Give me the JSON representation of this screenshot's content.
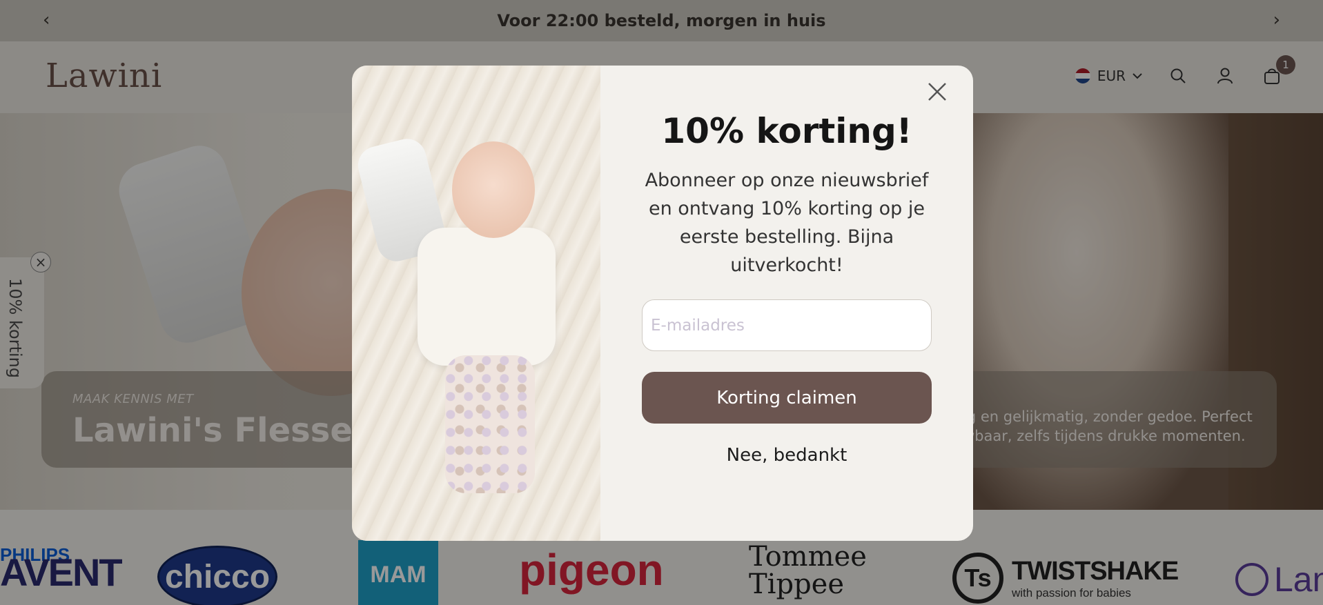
{
  "announcement": {
    "text": "Voor 22:00 besteld, morgen in huis",
    "prev_icon": "chevron-left-icon",
    "next_icon": "chevron-right-icon"
  },
  "header": {
    "logo": "Lawini",
    "currency": "EUR",
    "currency_icon": "netherlands-flag-icon",
    "cart_count": "1",
    "colors": {
      "accent": "#6b5550",
      "logo": "#6a5048"
    }
  },
  "hero": {
    "kicker": "MAAK KENNIS MET",
    "headline": "Lawini's Flessenv",
    "description": "ig en gelijkmatig, zonder gedoe. Perfect wbaar, zelfs tijdens drukke momenten."
  },
  "side_tab": {
    "label": "10% korting",
    "close_icon": "close-icon"
  },
  "brands": [
    {
      "name": "PHILIPS",
      "sub": "AVENT"
    },
    {
      "name": "chicco"
    },
    {
      "name": "MAM"
    },
    {
      "name": "pigeon"
    },
    {
      "name": "Tommee",
      "sub": "Tippee"
    },
    {
      "name": "TWISTSHAKE",
      "sub": "with passion for babies",
      "mark": "Ts"
    },
    {
      "name": "Lan"
    }
  ],
  "modal": {
    "title": "10% korting!",
    "text": "Abonneer op onze nieuwsbrief en ontvang 10% korting op je eerste bestelling. Bijna uitverkocht!",
    "email_placeholder": "E-mailadres",
    "email_value": "",
    "claim_label": "Korting claimen",
    "decline_label": "Nee, bedankt",
    "colors": {
      "button": "#6b5550",
      "background": "#f3f1ed"
    }
  }
}
